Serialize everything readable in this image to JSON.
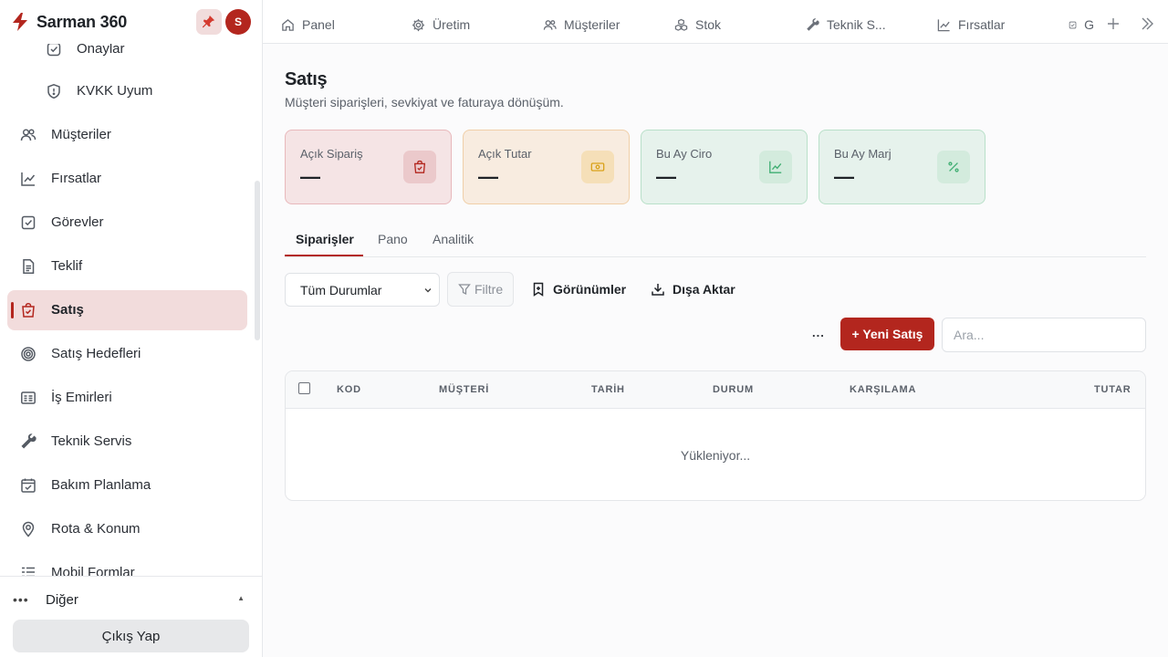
{
  "app": {
    "name": "Sarman 360",
    "avatar_initial": "S"
  },
  "sidebar": {
    "items": [
      {
        "label": "Onaylar",
        "icon": "check-square-icon"
      },
      {
        "label": "KVKK Uyum",
        "icon": "shield-icon"
      },
      {
        "label": "Müşteriler",
        "icon": "users-icon"
      },
      {
        "label": "Fırsatlar",
        "icon": "trend-chart-icon"
      },
      {
        "label": "Görevler",
        "icon": "check-square-icon"
      },
      {
        "label": "Teklif",
        "icon": "document-icon"
      },
      {
        "label": "Satış",
        "icon": "shopping-bag-icon",
        "active": true
      },
      {
        "label": "Satış Hedefleri",
        "icon": "target-icon"
      },
      {
        "label": "İş Emirleri",
        "icon": "id-card-icon"
      },
      {
        "label": "Teknik Servis",
        "icon": "wrench-icon"
      },
      {
        "label": "Bakım Planlama",
        "icon": "calendar-check-icon"
      },
      {
        "label": "Rota & Konum",
        "icon": "map-pin-icon"
      },
      {
        "label": "Mobil Formlar",
        "icon": "list-icon"
      }
    ],
    "other_label": "Diğer",
    "logout_label": "Çıkış Yap"
  },
  "topbar": {
    "tabs": [
      {
        "label": "Panel",
        "icon": "home-icon"
      },
      {
        "label": "Üretim",
        "icon": "gear-icon"
      },
      {
        "label": "Müşteriler",
        "icon": "users-icon"
      },
      {
        "label": "Stok",
        "icon": "boxes-icon"
      },
      {
        "label": "Teknik S...",
        "icon": "wrench-icon"
      },
      {
        "label": "Fırsatlar",
        "icon": "trend-chart-icon"
      },
      {
        "label": "G",
        "icon": "check-square-icon"
      }
    ]
  },
  "page": {
    "title": "Satış",
    "subtitle": "Müşteri siparişleri, sevkiyat ve faturaya dönüşüm."
  },
  "cards": [
    {
      "label": "Açık Sipariş",
      "value": "—",
      "icon": "shopping-bag-icon",
      "accent": "#b3261e"
    },
    {
      "label": "Açık Tutar",
      "value": "—",
      "icon": "cash-icon",
      "accent": "#d9a21b"
    },
    {
      "label": "Bu Ay Ciro",
      "value": "—",
      "icon": "trend-chart-icon",
      "accent": "#3fae72"
    },
    {
      "label": "Bu Ay Marj",
      "value": "—",
      "icon": "percent-icon",
      "accent": "#3fae72"
    }
  ],
  "tabs": [
    {
      "label": "Siparişler",
      "active": true
    },
    {
      "label": "Pano"
    },
    {
      "label": "Analitik"
    }
  ],
  "toolbar": {
    "status_select": "Tüm Durumlar",
    "filter_label": "Filtre",
    "views_label": "Görünümler",
    "export_label": "Dışa Aktar",
    "more_label": "...",
    "new_label": "+ Yeni Satış",
    "search_placeholder": "Ara..."
  },
  "table": {
    "columns": [
      "KOD",
      "MÜŞTERİ",
      "TARİH",
      "DURUM",
      "KARŞILAMA",
      "TUTAR"
    ],
    "loading_text": "Yükleniyor..."
  },
  "colors": {
    "brand": "#b3261e",
    "active_bg": "#f2dcdc"
  }
}
